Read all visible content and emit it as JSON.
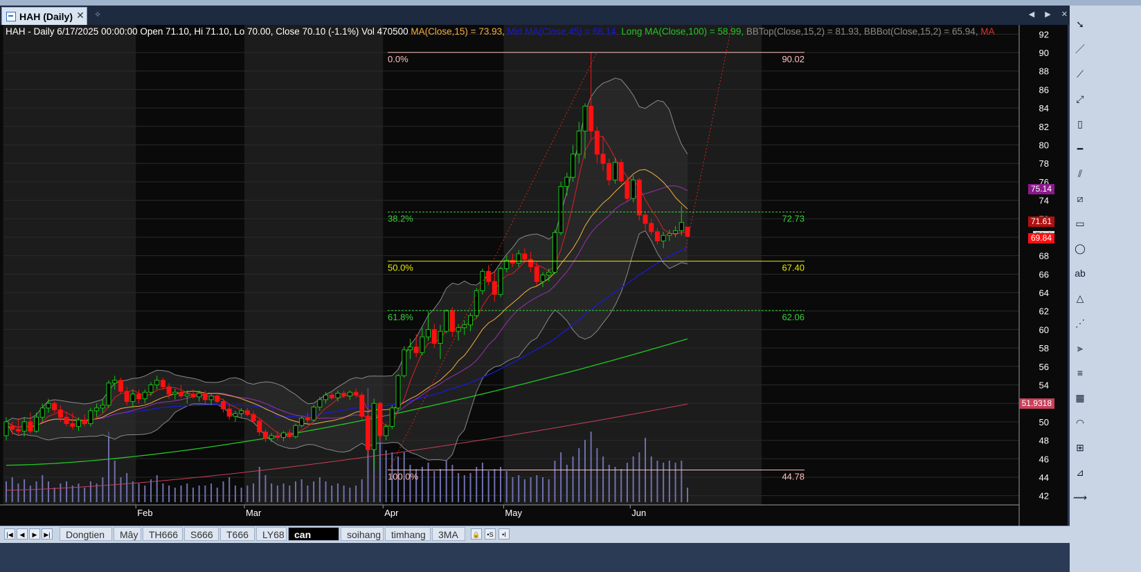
{
  "window": {
    "tab_title": "HAH (Daily)",
    "close_glyph": "✕",
    "pin_glyph": "✧",
    "nav_arrows": "◀ ▶ ✕"
  },
  "header": {
    "symbol_info": "HAH - Daily 6/17/2025 00:00:00 Open 71.10, Hi 71.10, Lo 70.00, Close 70.10 (-1.1%) Vol 470500",
    "ma15": "MA(Close,15) = 73.93,",
    "ma45": "Mid MA(Close,45) = 68.14,",
    "ma100": "Long MA(Close,100) = 58.99,",
    "bbtop": "BBTop(Close,15,2) = 81.93,",
    "bbbot": "BBBot(Close,15,2) = 65.94,",
    "ma_tail": "MA"
  },
  "colors": {
    "ma15": "#f5b041",
    "ma45": "#1a1ad6",
    "ma100": "#22c922",
    "bb": "#8a8a8a",
    "ma_tail": "#e03030",
    "up_candle": "#18c818",
    "down_candle": "#ff1010",
    "fib_base": "#ffc0c0",
    "fib_382": "#3ad03a",
    "fib_500": "#e8e800",
    "fib_618": "#3ad03a",
    "volume": "#7070b0"
  },
  "y_axis": {
    "min": 41,
    "max": 93,
    "ticks": [
      42,
      44,
      46,
      48,
      50,
      52,
      54,
      56,
      58,
      60,
      62,
      64,
      66,
      68,
      70,
      72,
      74,
      76,
      78,
      80,
      82,
      84,
      86,
      88,
      90,
      92
    ]
  },
  "x_axis": {
    "months": [
      "Feb",
      "Mar",
      "Apr",
      "May",
      "Jun"
    ]
  },
  "fib_levels": [
    {
      "left_label": "0.0%",
      "right_label": "90.02",
      "value": 90.02
    },
    {
      "left_label": "38.2%",
      "right_label": "72.73",
      "value": 72.73
    },
    {
      "left_label": "50.0%",
      "right_label": "67.40",
      "value": 67.4
    },
    {
      "left_label": "61.8%",
      "right_label": "62.06",
      "value": 62.06
    },
    {
      "left_label": "100.0%",
      "right_label": "44.78",
      "value": 44.78
    }
  ],
  "price_tags": [
    {
      "label": "75.14",
      "value": 75.14,
      "bg": "#8a1a8a",
      "color": "#ffffff"
    },
    {
      "label": "71.61",
      "value": 71.61,
      "bg": "#b01010",
      "color": "#ffffff"
    },
    {
      "label": "70.1",
      "value": 70.1,
      "bg": "#d8d8d8",
      "color": "#000000"
    },
    {
      "label": "69.84",
      "value": 69.84,
      "bg": "#ff1010",
      "color": "#ffffff"
    },
    {
      "label": "51.9318",
      "value": 51.9318,
      "bg": "#c8405a",
      "color": "#ffffff"
    }
  ],
  "sheet_tabs": [
    "Dongtien",
    "Mây",
    "TH666",
    "S666",
    "T666",
    "LY68",
    "can cheo",
    "soihang",
    "timhang",
    "3MA"
  ],
  "active_sheet": "can cheo",
  "sheet_nav": [
    "|◀",
    "◀",
    "▶",
    "▶|"
  ],
  "sheet_tools": [
    "🔒",
    "•S",
    "•I"
  ],
  "right_tools": [
    "pointer-icon",
    "line-tool-icon",
    "polyline-tool-icon",
    "ray-tool-icon",
    "vertical-line-icon",
    "horizontal-line-icon",
    "parallel-lines-icon",
    "channel-icon",
    "rectangle-icon",
    "ellipse-icon",
    "text-tool-icon",
    "triangle-icon",
    "fib-fan-icon",
    "gann-fan-icon",
    "list-icon",
    "bars-icon",
    "arc-icon",
    "grid-icon",
    "fib-retracement-icon",
    "andrews-pitchfork-icon"
  ],
  "right_tool_glyphs": [
    "➘",
    "／",
    "⟋",
    "⤢",
    "▯",
    "━",
    "⫽",
    "⧄",
    "▭",
    "◯",
    "ab",
    "△",
    "⋰",
    "⫸",
    "≡",
    "▦",
    "◠",
    "⊞",
    "⊿",
    "⟿"
  ],
  "chart_data": {
    "type": "candlestick",
    "symbol": "HAH",
    "interval": "Daily",
    "last_bar": {
      "date": "6/17/2025",
      "open": 71.1,
      "high": 71.1,
      "low": 70.0,
      "close": 70.1,
      "change_pct": -1.1,
      "volume": 470500
    },
    "indicators": {
      "MA(Close,15)": 73.93,
      "Mid MA(Close,45)": 68.14,
      "Long MA(Close,100)": 58.99,
      "BBTop(Close,15,2)": 81.93,
      "BBBot(Close,15,2)": 65.94
    },
    "fibonacci": {
      "high": 90.02,
      "low": 44.78,
      "levels": {
        "0.0%": 90.02,
        "38.2%": 72.73,
        "50.0%": 67.4,
        "61.8%": 62.06,
        "100.0%": 44.78
      }
    },
    "y_range": [
      41,
      93
    ],
    "bars": [
      {
        "o": 48.5,
        "h": 50.5,
        "l": 48,
        "c": 50,
        "v": 0.1
      },
      {
        "o": 49.5,
        "h": 50,
        "l": 48.6,
        "c": 49.2,
        "v": 0.12
      },
      {
        "o": 49.2,
        "h": 50.4,
        "l": 48.5,
        "c": 49,
        "v": 0.09
      },
      {
        "o": 49,
        "h": 50.5,
        "l": 48.4,
        "c": 50,
        "v": 0.11
      },
      {
        "o": 50,
        "h": 51,
        "l": 48.7,
        "c": 49,
        "v": 0.08
      },
      {
        "o": 49,
        "h": 51,
        "l": 48.8,
        "c": 50.5,
        "v": 0.1
      },
      {
        "o": 50.5,
        "h": 52,
        "l": 50,
        "c": 51.5,
        "v": 0.13
      },
      {
        "o": 51.5,
        "h": 52.5,
        "l": 51,
        "c": 52,
        "v": 0.1
      },
      {
        "o": 52,
        "h": 52.3,
        "l": 51,
        "c": 51.3,
        "v": 0.07
      },
      {
        "o": 51.3,
        "h": 51.8,
        "l": 50,
        "c": 50.5,
        "v": 0.09
      },
      {
        "o": 50.5,
        "h": 51,
        "l": 49.5,
        "c": 49.8,
        "v": 0.1
      },
      {
        "o": 49.8,
        "h": 51,
        "l": 49.2,
        "c": 49.5,
        "v": 0.08
      },
      {
        "o": 49.5,
        "h": 50.5,
        "l": 49,
        "c": 50.2,
        "v": 0.09
      },
      {
        "o": 50.2,
        "h": 50.8,
        "l": 49.5,
        "c": 49.8,
        "v": 0.07
      },
      {
        "o": 49.8,
        "h": 51.5,
        "l": 49.5,
        "c": 51.2,
        "v": 0.1
      },
      {
        "o": 51.2,
        "h": 52,
        "l": 50.5,
        "c": 51.5,
        "v": 0.09
      },
      {
        "o": 51.5,
        "h": 52.5,
        "l": 51,
        "c": 51.8,
        "v": 0.12
      },
      {
        "o": 51.8,
        "h": 54.5,
        "l": 51.5,
        "c": 54.2,
        "v": 0.34
      },
      {
        "o": 54.2,
        "h": 55,
        "l": 53.5,
        "c": 54.5,
        "v": 0.2
      },
      {
        "o": 54.5,
        "h": 54.8,
        "l": 53,
        "c": 53.3,
        "v": 0.12
      },
      {
        "o": 53.3,
        "h": 53.8,
        "l": 51.8,
        "c": 52.2,
        "v": 0.14
      },
      {
        "o": 52.2,
        "h": 53.5,
        "l": 51.5,
        "c": 53,
        "v": 0.1
      },
      {
        "o": 53,
        "h": 53.5,
        "l": 52,
        "c": 52.5,
        "v": 0.09
      },
      {
        "o": 52.5,
        "h": 53.5,
        "l": 52,
        "c": 53.2,
        "v": 0.08
      },
      {
        "o": 53.2,
        "h": 54.3,
        "l": 52.8,
        "c": 54,
        "v": 0.11
      },
      {
        "o": 54,
        "h": 55,
        "l": 53.5,
        "c": 54.5,
        "v": 0.13
      },
      {
        "o": 54.5,
        "h": 54.8,
        "l": 53.5,
        "c": 53.8,
        "v": 0.09
      },
      {
        "o": 53.8,
        "h": 54.2,
        "l": 52.5,
        "c": 53,
        "v": 0.08
      },
      {
        "o": 53,
        "h": 53.6,
        "l": 52.4,
        "c": 53.2,
        "v": 0.07
      },
      {
        "o": 53.2,
        "h": 54,
        "l": 52.6,
        "c": 52.8,
        "v": 0.08
      },
      {
        "o": 52.8,
        "h": 53.4,
        "l": 52,
        "c": 53,
        "v": 0.09
      },
      {
        "o": 53,
        "h": 53.5,
        "l": 52.5,
        "c": 52.7,
        "v": 0.07
      },
      {
        "o": 52.7,
        "h": 53.4,
        "l": 52.2,
        "c": 53.1,
        "v": 0.08
      },
      {
        "o": 53.1,
        "h": 53.4,
        "l": 52,
        "c": 52.4,
        "v": 0.08
      },
      {
        "o": 52.4,
        "h": 53,
        "l": 51.8,
        "c": 52.8,
        "v": 0.09
      },
      {
        "o": 52.8,
        "h": 53.2,
        "l": 52,
        "c": 52.2,
        "v": 0.07
      },
      {
        "o": 52.2,
        "h": 52.5,
        "l": 51,
        "c": 51.4,
        "v": 0.1
      },
      {
        "o": 51.4,
        "h": 51.8,
        "l": 50.2,
        "c": 50.6,
        "v": 0.12
      },
      {
        "o": 50.6,
        "h": 51.2,
        "l": 50,
        "c": 50.9,
        "v": 0.08
      },
      {
        "o": 50.9,
        "h": 51.5,
        "l": 50.5,
        "c": 51.2,
        "v": 0.07
      },
      {
        "o": 51.2,
        "h": 51.5,
        "l": 50.6,
        "c": 50.8,
        "v": 0.08
      },
      {
        "o": 50.8,
        "h": 51.2,
        "l": 49.8,
        "c": 50.1,
        "v": 0.09
      },
      {
        "o": 50.1,
        "h": 50.3,
        "l": 48.5,
        "c": 48.9,
        "v": 0.17
      },
      {
        "o": 48.9,
        "h": 49.2,
        "l": 47.8,
        "c": 48.2,
        "v": 0.13
      },
      {
        "o": 48.2,
        "h": 48.8,
        "l": 47.8,
        "c": 48.5,
        "v": 0.09
      },
      {
        "o": 48.5,
        "h": 49,
        "l": 48,
        "c": 48.3,
        "v": 0.08
      },
      {
        "o": 48.3,
        "h": 49,
        "l": 47.9,
        "c": 48.8,
        "v": 0.09
      },
      {
        "o": 48.8,
        "h": 49.2,
        "l": 48.2,
        "c": 48.4,
        "v": 0.08
      },
      {
        "o": 48.4,
        "h": 49.8,
        "l": 48.2,
        "c": 49.6,
        "v": 0.1
      },
      {
        "o": 49.6,
        "h": 50.6,
        "l": 49.4,
        "c": 50.4,
        "v": 0.11
      },
      {
        "o": 50.4,
        "h": 51,
        "l": 49.8,
        "c": 50.2,
        "v": 0.08
      },
      {
        "o": 50.2,
        "h": 51.8,
        "l": 50,
        "c": 51.6,
        "v": 0.1
      },
      {
        "o": 51.6,
        "h": 52.7,
        "l": 51.2,
        "c": 52.4,
        "v": 0.12
      },
      {
        "o": 52.4,
        "h": 53.2,
        "l": 52,
        "c": 52.9,
        "v": 0.1
      },
      {
        "o": 52.9,
        "h": 53.2,
        "l": 52.4,
        "c": 52.6,
        "v": 0.08
      },
      {
        "o": 52.6,
        "h": 53.4,
        "l": 52.2,
        "c": 53.1,
        "v": 0.09
      },
      {
        "o": 53.1,
        "h": 53.4,
        "l": 52.6,
        "c": 52.8,
        "v": 0.08
      },
      {
        "o": 52.8,
        "h": 53.4,
        "l": 52.4,
        "c": 53.2,
        "v": 0.07
      },
      {
        "o": 53.2,
        "h": 53.6,
        "l": 52.6,
        "c": 52.9,
        "v": 0.08
      },
      {
        "o": 52.9,
        "h": 53.2,
        "l": 50.2,
        "c": 50.6,
        "v": 0.11
      },
      {
        "o": 50.6,
        "h": 51,
        "l": 46.5,
        "c": 47,
        "v": 0.55
      },
      {
        "o": 47,
        "h": 52.5,
        "l": 44.8,
        "c": 52,
        "v": 0.4
      },
      {
        "o": 52,
        "h": 52.2,
        "l": 48,
        "c": 48.5,
        "v": 0.37
      },
      {
        "o": 48.5,
        "h": 49.8,
        "l": 48,
        "c": 49.5,
        "v": 0.25
      },
      {
        "o": 49.5,
        "h": 51.8,
        "l": 49.2,
        "c": 51.5,
        "v": 0.24
      },
      {
        "o": 51.5,
        "h": 55.2,
        "l": 51.2,
        "c": 55,
        "v": 0.22
      },
      {
        "o": 55,
        "h": 58.2,
        "l": 54.8,
        "c": 57.8,
        "v": 0.24
      },
      {
        "o": 57.8,
        "h": 59,
        "l": 56.8,
        "c": 58.1,
        "v": 0.18
      },
      {
        "o": 58.1,
        "h": 59.5,
        "l": 57,
        "c": 57.5,
        "v": 0.16
      },
      {
        "o": 57.5,
        "h": 60.2,
        "l": 57.2,
        "c": 59.2,
        "v": 0.17
      },
      {
        "o": 59.2,
        "h": 62,
        "l": 58.8,
        "c": 60,
        "v": 0.19
      },
      {
        "o": 60,
        "h": 60.6,
        "l": 58,
        "c": 58.5,
        "v": 0.15
      },
      {
        "o": 58.5,
        "h": 60.5,
        "l": 56.8,
        "c": 59.8,
        "v": 0.16
      },
      {
        "o": 59.8,
        "h": 62.2,
        "l": 59.6,
        "c": 62,
        "v": 0.2
      },
      {
        "o": 62,
        "h": 62.4,
        "l": 59.2,
        "c": 59.8,
        "v": 0.18
      },
      {
        "o": 59.8,
        "h": 60.6,
        "l": 58.8,
        "c": 60.2,
        "v": 0.14
      },
      {
        "o": 60.2,
        "h": 61,
        "l": 59.4,
        "c": 60.5,
        "v": 0.13
      },
      {
        "o": 60.5,
        "h": 61.8,
        "l": 59.8,
        "c": 61.5,
        "v": 0.14
      },
      {
        "o": 61.5,
        "h": 64.5,
        "l": 61.2,
        "c": 64.2,
        "v": 0.17
      },
      {
        "o": 64.2,
        "h": 66.6,
        "l": 63.8,
        "c": 66.3,
        "v": 0.19
      },
      {
        "o": 66.3,
        "h": 67,
        "l": 64.8,
        "c": 65.2,
        "v": 0.15
      },
      {
        "o": 65.2,
        "h": 66.4,
        "l": 63,
        "c": 63.8,
        "v": 0.16
      },
      {
        "o": 63.8,
        "h": 66.8,
        "l": 63.5,
        "c": 66.6,
        "v": 0.17
      },
      {
        "o": 66.6,
        "h": 68,
        "l": 66.2,
        "c": 67.5,
        "v": 0.15
      },
      {
        "o": 67.5,
        "h": 68.2,
        "l": 66.8,
        "c": 67.2,
        "v": 0.12
      },
      {
        "o": 67.2,
        "h": 68.6,
        "l": 66.8,
        "c": 68.2,
        "v": 0.13
      },
      {
        "o": 68.2,
        "h": 68.8,
        "l": 67.2,
        "c": 67.6,
        "v": 0.11
      },
      {
        "o": 67.6,
        "h": 68.4,
        "l": 66.2,
        "c": 66.8,
        "v": 0.12
      },
      {
        "o": 66.8,
        "h": 67.4,
        "l": 64.8,
        "c": 65.2,
        "v": 0.13
      },
      {
        "o": 65.2,
        "h": 66.2,
        "l": 64.6,
        "c": 65.9,
        "v": 0.12
      },
      {
        "o": 65.9,
        "h": 66.6,
        "l": 65.2,
        "c": 66.2,
        "v": 0.11
      },
      {
        "o": 66.2,
        "h": 70.8,
        "l": 66,
        "c": 70.5,
        "v": 0.2
      },
      {
        "o": 70.5,
        "h": 76,
        "l": 70.2,
        "c": 75.5,
        "v": 0.24
      },
      {
        "o": 75.5,
        "h": 77,
        "l": 74.5,
        "c": 76.5,
        "v": 0.18
      },
      {
        "o": 76.5,
        "h": 80,
        "l": 76,
        "c": 79,
        "v": 0.22
      },
      {
        "o": 79,
        "h": 82.5,
        "l": 78,
        "c": 81.5,
        "v": 0.26
      },
      {
        "o": 81.5,
        "h": 84.5,
        "l": 78.5,
        "c": 84.2,
        "v": 0.3
      },
      {
        "o": 84.2,
        "h": 90,
        "l": 80.5,
        "c": 81.5,
        "v": 0.34
      },
      {
        "o": 81.5,
        "h": 82,
        "l": 78,
        "c": 79,
        "v": 0.26
      },
      {
        "o": 79,
        "h": 81,
        "l": 77.2,
        "c": 78,
        "v": 0.22
      },
      {
        "o": 78,
        "h": 78.5,
        "l": 75.6,
        "c": 76.2,
        "v": 0.18
      },
      {
        "o": 76.2,
        "h": 78.6,
        "l": 75.8,
        "c": 78.1,
        "v": 0.17
      },
      {
        "o": 78.1,
        "h": 78.5,
        "l": 75.8,
        "c": 76.1,
        "v": 0.16
      },
      {
        "o": 76.1,
        "h": 76.6,
        "l": 73.8,
        "c": 74.2,
        "v": 0.19
      },
      {
        "o": 74.2,
        "h": 76.7,
        "l": 73.8,
        "c": 76.2,
        "v": 0.22
      },
      {
        "o": 76.2,
        "h": 76.4,
        "l": 71.8,
        "c": 72.4,
        "v": 0.24
      },
      {
        "o": 72.4,
        "h": 72.8,
        "l": 70.8,
        "c": 71.5,
        "v": 0.31
      },
      {
        "o": 71.5,
        "h": 72,
        "l": 70.2,
        "c": 70.6,
        "v": 0.22
      },
      {
        "o": 70.6,
        "h": 71,
        "l": 69.2,
        "c": 69.6,
        "v": 0.2
      },
      {
        "o": 69.6,
        "h": 70.6,
        "l": 68.8,
        "c": 70.2,
        "v": 0.19
      },
      {
        "o": 70.2,
        "h": 70.8,
        "l": 69.6,
        "c": 70.4,
        "v": 0.2
      },
      {
        "o": 70.4,
        "h": 71.2,
        "l": 70,
        "c": 70.7,
        "v": 0.19
      },
      {
        "o": 70.7,
        "h": 73.4,
        "l": 70.2,
        "c": 71.6,
        "v": 0.2
      },
      {
        "o": 71.1,
        "h": 71.1,
        "l": 70,
        "c": 70.1,
        "v": 0.07
      }
    ]
  }
}
